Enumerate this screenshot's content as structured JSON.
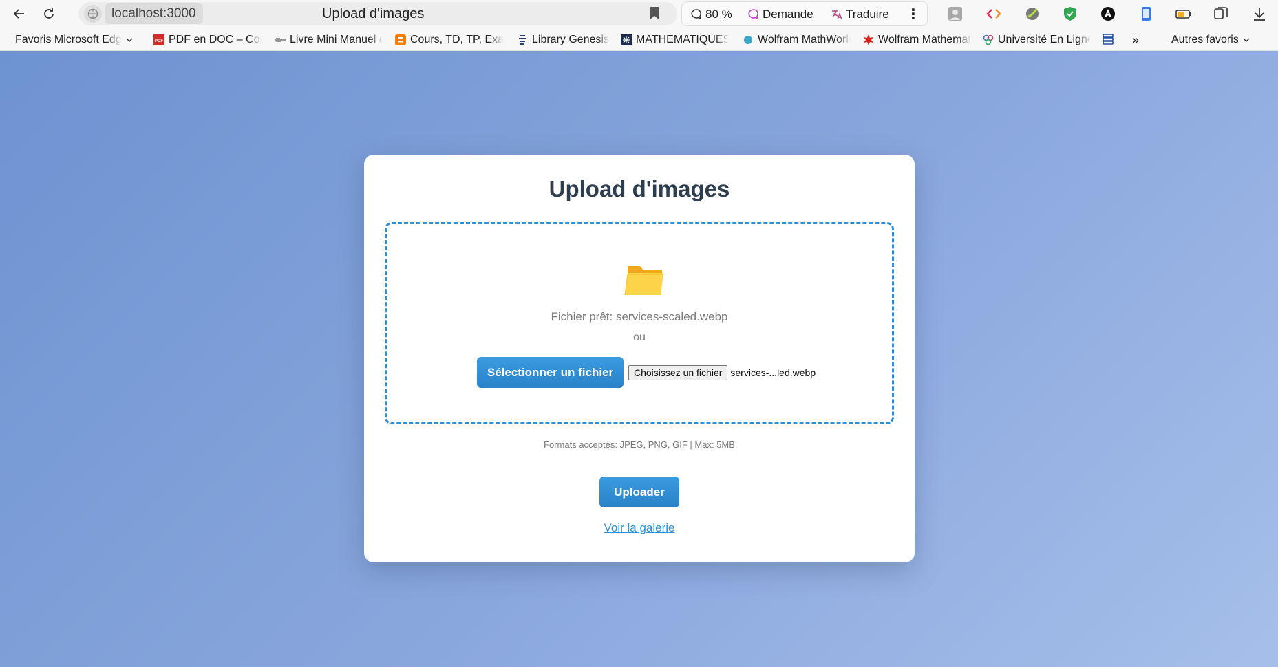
{
  "browser": {
    "url": "localhost:3000",
    "tab_title": "Upload d'images",
    "zoom": "80 %",
    "demande_label": "Demande",
    "traduire_label": "Traduire",
    "bookmarks": [
      "Favoris Microsoft Edge",
      "PDF en DOC – Convertir",
      "Livre Mini Manuel de",
      "Cours, TD, TP, Examens",
      "Library Genesis",
      "MATHEMATIQUES",
      "Wolfram MathWorld",
      "Wolfram Mathematica",
      "Université En Ligne"
    ],
    "other_favorites": "Autres favoris",
    "overflow": "»"
  },
  "card": {
    "title": "Upload d'images",
    "status_text": "Fichier prêt: services-scaled.webp",
    "or_text": "ou",
    "select_button": "Sélectionner un fichier",
    "native_button": "Choisissez un fichier",
    "native_filename": "services-...led.webp",
    "formats_note": "Formats acceptés: JPEG, PNG, GIF | Max: 5MB",
    "upload_button": "Uploader",
    "gallery_link": "Voir la galerie"
  },
  "colors": {
    "accent": "#2e8fd4",
    "title": "#2c3e50",
    "background_start": "#6e93d1",
    "background_end": "#a6bfea",
    "folder": "#f9c934"
  }
}
